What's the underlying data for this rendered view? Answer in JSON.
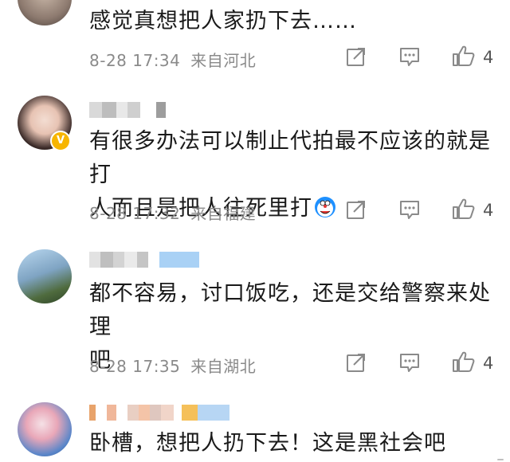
{
  "comments": [
    {
      "text": "感觉真想把人家扔下去……",
      "time": "8-28 17:34",
      "location": "来自河北",
      "likes": "4"
    },
    {
      "text_line1": "有很多办法可以制止代拍最不应该的就是打",
      "text_line2": "人而且是把人往死里打",
      "time": "8-28 17:32",
      "location": "来自福建",
      "likes": "4"
    },
    {
      "text_line1": "都不容易，讨口饭吃，还是交给警察来处理",
      "text_line2": "吧",
      "time": "8-28 17:35",
      "location": "来自湖北",
      "likes": "4"
    },
    {
      "text": "卧槽，想把人扔下去！这是黑社会吧"
    }
  ],
  "icons": {
    "share": "share-icon",
    "comment": "comment-icon",
    "like": "thumbs-up-icon",
    "emoji": "doraemon-emoji-icon",
    "verified": "verified-badge-icon"
  },
  "colors": {
    "meta_gray": "#8a8a8a",
    "badge_gold": "#f7b500",
    "icon_gray": "#8a8a8a"
  }
}
